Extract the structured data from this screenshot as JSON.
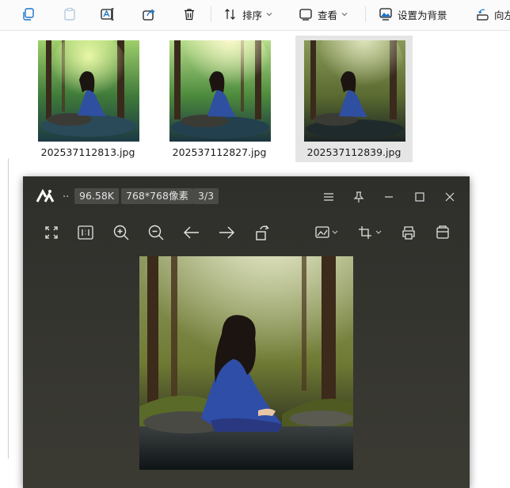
{
  "toolbar": {
    "sort_label": "排序",
    "view_label": "查看",
    "set_bg_label": "设置为背景",
    "rotate_label": "向左"
  },
  "files": [
    {
      "name": "202537112813.jpg",
      "selected": false
    },
    {
      "name": "202537112827.jpg",
      "selected": false
    },
    {
      "name": "202537112839.jpg",
      "selected": true
    }
  ],
  "viewer": {
    "dots": "..",
    "file_size": "96.58K",
    "dimensions": "768*768像素",
    "position": "3/3"
  },
  "colors": {
    "viewer_bg": "#34342f",
    "badge_bg": "#4a4a46",
    "accent": "#0067c0",
    "selection": "#e5e5e5"
  }
}
